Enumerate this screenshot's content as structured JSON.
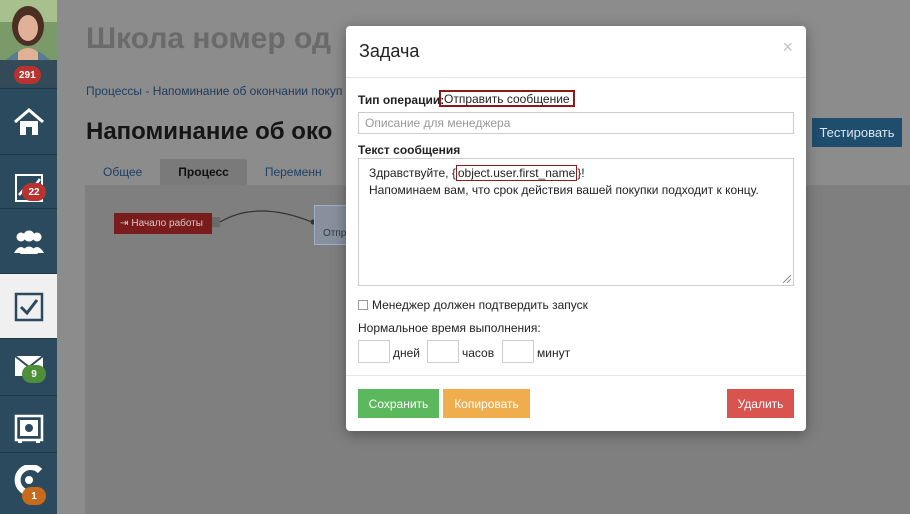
{
  "sidebar": {
    "user_badge": "291",
    "items": [
      {
        "icon": "home-icon",
        "badge": ""
      },
      {
        "icon": "chart-icon",
        "badge": "22"
      },
      {
        "icon": "users-icon",
        "badge": ""
      },
      {
        "icon": "checkbox-icon",
        "badge": "",
        "active": true
      },
      {
        "icon": "mail-icon",
        "badge": "9"
      },
      {
        "icon": "safe-icon",
        "badge": ""
      },
      {
        "icon": "brand-logo-icon",
        "badge": "1"
      }
    ]
  },
  "page": {
    "title": "Школа номер од",
    "breadcrumb": {
      "link": "Процессы",
      "separator": " - ",
      "current": "Напоминание об окончании покуп"
    },
    "heading": "Напоминание об око",
    "test_button": "Тестировать",
    "tabs": [
      "Общее",
      "Процесс",
      "Переменн"
    ],
    "active_tab": "Процесс",
    "node_start": "Начало работы",
    "node_send": "Отпр"
  },
  "modal": {
    "title": "Задача",
    "close": "×",
    "op_type_label": "Тип операции:",
    "op_type_value": "Отправить сообщение",
    "description_placeholder": "Описание для менеджера",
    "message_label": "Текст сообщения",
    "message_line1_prefix": "Здравствуйте, {",
    "message_line1_var": "object.user.first_name",
    "message_line1_suffix": "}!",
    "message_line2": "Напоминаем вам, что срок действия вашей покупки подходит к концу.",
    "confirm_label": "Менеджер должен подтвердить запуск",
    "normal_time_label": "Нормальное время выполнения:",
    "days": "дней",
    "hours": "часов",
    "minutes": "минут",
    "save": "Сохранить",
    "copy": "Копировать",
    "delete": "Удалить"
  },
  "colors": {
    "sidebar": "#2b4a5e",
    "save": "#5cb85c",
    "copy": "#f0ad4e",
    "delete": "#d9534f",
    "highlight": "#8b1a1a"
  }
}
